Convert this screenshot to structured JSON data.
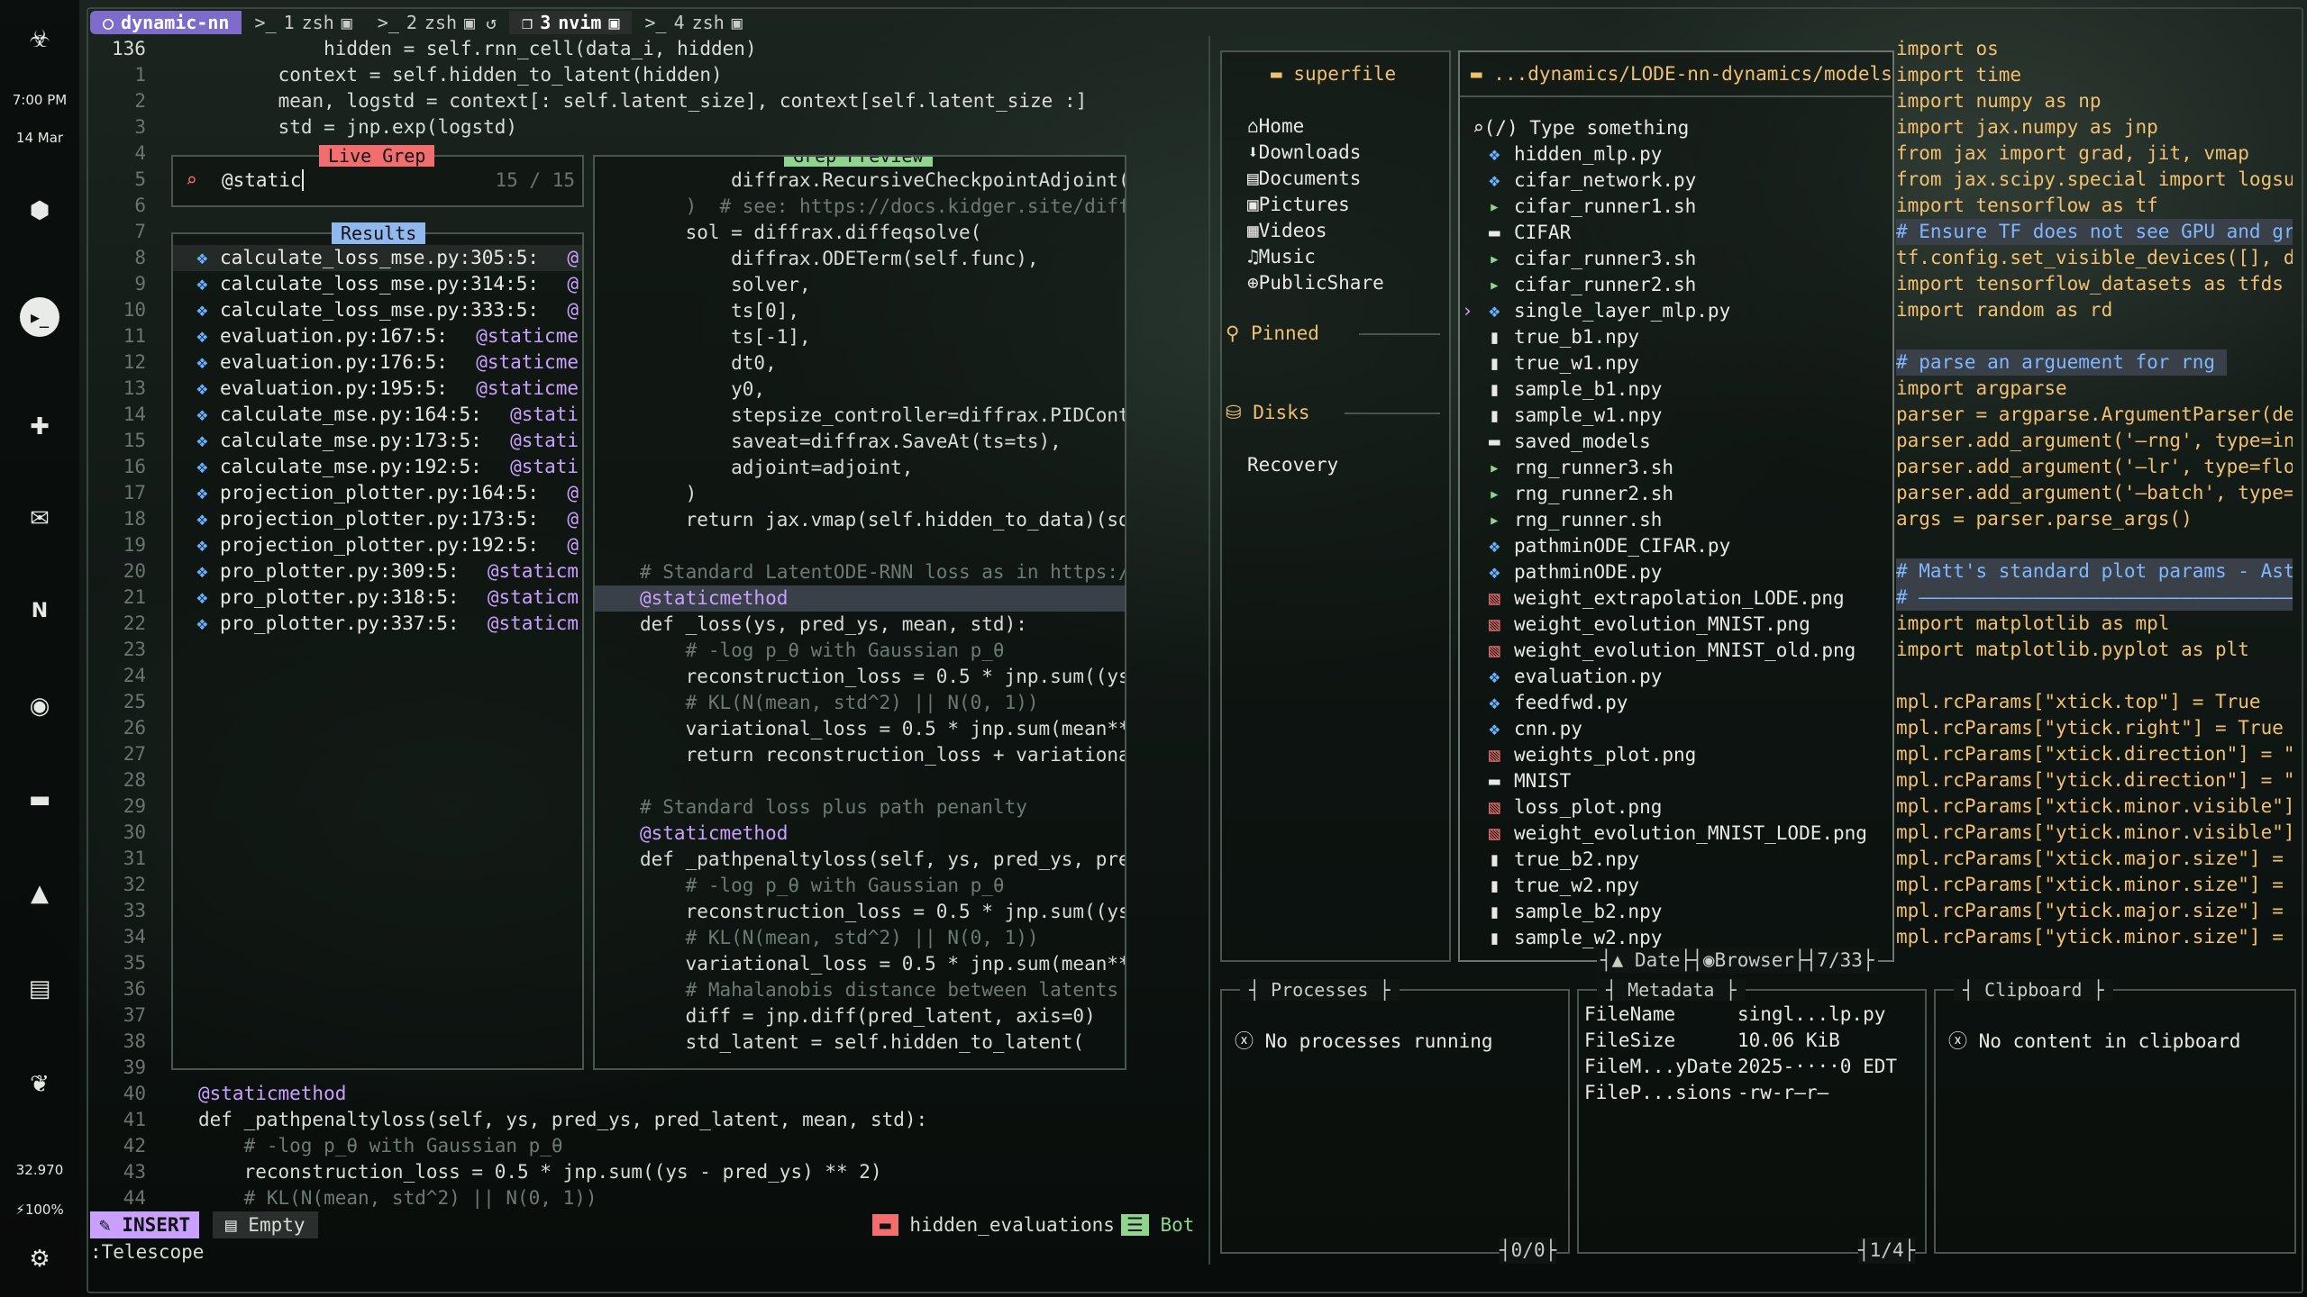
{
  "sidebar": {
    "clock_time": "7:00 PM",
    "clock_date": "14 Mar",
    "temperature": "32.970",
    "battery": "100%",
    "icons": [
      "biohazard-icon",
      "cube-icon",
      "terminal-icon",
      "slack-icon",
      "mail-icon",
      "notion-icon",
      "spotify-icon",
      "folder-icon",
      "graduation-icon",
      "notes-icon",
      "leaf-icon",
      "gear-icon"
    ]
  },
  "tabs": [
    {
      "label": "dynamic-nn",
      "num": ""
    },
    {
      "label": "zsh",
      "num": "1"
    },
    {
      "label": "zsh",
      "num": "2"
    },
    {
      "label": "nvim",
      "num": "3"
    },
    {
      "label": "zsh",
      "num": "4"
    }
  ],
  "editor": {
    "top_line_num": "136",
    "top_line": "        hidden = self.rnn_cell(data_i, hidden)",
    "lines_before": [
      {
        "n": "1",
        "t": "    context = self.hidden_to_latent(hidden)"
      },
      {
        "n": "2",
        "t": "    mean, logstd = context[: self.latent_size], context[self.latent_size :]"
      },
      {
        "n": "3",
        "t": "    std = jnp.exp(logstd)"
      }
    ],
    "gutter": [
      "4",
      "5",
      "6",
      "7",
      "8",
      "9",
      "10",
      "11",
      "12",
      "13",
      "14",
      "15",
      "16",
      "17",
      "18",
      "19",
      "20",
      "21",
      "22",
      "23",
      "24",
      "25",
      "26",
      "27",
      "28",
      "29",
      "30",
      "31",
      "32",
      "33",
      "34",
      "35",
      "36",
      "37",
      "38",
      "39"
    ],
    "lines_after": [
      {
        "n": "40",
        "t": "@staticmethod",
        "cls": "dec"
      },
      {
        "n": "41",
        "t": "def _pathpenaltyloss(self, ys, pred_ys, pred_latent, mean, std):",
        "cls": ""
      },
      {
        "n": "42",
        "t": "    # -log p_θ with Gaussian p_θ",
        "cls": "cm"
      },
      {
        "n": "43",
        "t": "    reconstruction_loss = 0.5 * jnp.sum((ys - pred_ys) ** 2)",
        "cls": ""
      },
      {
        "n": "44",
        "t": "    # KL(N(mean, std^2) || N(0, 1))",
        "cls": "cm"
      }
    ]
  },
  "telescope": {
    "live_grep_title": "Live Grep",
    "query": "@static",
    "count": "15 / 15",
    "results_title": "Results",
    "results": [
      {
        "file": "calculate_loss_mse.py:305:5:",
        "match": "@"
      },
      {
        "file": "calculate_loss_mse.py:314:5:",
        "match": "@"
      },
      {
        "file": "calculate_loss_mse.py:333:5:",
        "match": "@"
      },
      {
        "file": "evaluation.py:167:5:",
        "match": "@staticme"
      },
      {
        "file": "evaluation.py:176:5:",
        "match": "@staticme"
      },
      {
        "file": "evaluation.py:195:5:",
        "match": "@staticme"
      },
      {
        "file": "calculate_mse.py:164:5:",
        "match": "@stati"
      },
      {
        "file": "calculate_mse.py:173:5:",
        "match": "@stati"
      },
      {
        "file": "calculate_mse.py:192:5:",
        "match": "@stati"
      },
      {
        "file": "projection_plotter.py:164:5:",
        "match": "@"
      },
      {
        "file": "projection_plotter.py:173:5:",
        "match": "@"
      },
      {
        "file": "projection_plotter.py:192:5:",
        "match": "@"
      },
      {
        "file": "pro_plotter.py:309:5:",
        "match": "@staticm"
      },
      {
        "file": "pro_plotter.py:318:5:",
        "match": "@staticm"
      },
      {
        "file": "pro_plotter.py:337:5:",
        "match": "@staticm"
      }
    ],
    "preview_title": "Grep Preview",
    "preview": [
      {
        "t": "        diffrax.RecursiveCheckpointAdjoint()",
        "cls": ""
      },
      {
        "t": "    )  # see: https://docs.kidger.site/diffr",
        "cls": "cm"
      },
      {
        "t": "    sol = diffrax.diffeqsolve(",
        "cls": ""
      },
      {
        "t": "        diffrax.ODETerm(self.func),",
        "cls": ""
      },
      {
        "t": "        solver,",
        "cls": ""
      },
      {
        "t": "        ts[0],",
        "cls": ""
      },
      {
        "t": "        ts[-1],",
        "cls": ""
      },
      {
        "t": "        dt0,",
        "cls": ""
      },
      {
        "t": "        y0,",
        "cls": ""
      },
      {
        "t": "        stepsize_controller=diffrax.PIDContr",
        "cls": ""
      },
      {
        "t": "        saveat=diffrax.SaveAt(ts=ts),",
        "cls": ""
      },
      {
        "t": "        adjoint=adjoint,",
        "cls": ""
      },
      {
        "t": "    )",
        "cls": ""
      },
      {
        "t": "    return jax.vmap(self.hidden_to_data)(sol",
        "cls": ""
      },
      {
        "t": "",
        "cls": ""
      },
      {
        "t": "# Standard LatentODE-RNN loss as in https://",
        "cls": "cm"
      },
      {
        "t": "@staticmethod",
        "cls": "dec hl"
      },
      {
        "t": "def _loss(ys, pred_ys, mean, std):",
        "cls": ""
      },
      {
        "t": "    # -log p_θ with Gaussian p_θ",
        "cls": "cm"
      },
      {
        "t": "    reconstruction_loss = 0.5 * jnp.sum((ys",
        "cls": ""
      },
      {
        "t": "    # KL(N(mean, std^2) || N(0, 1))",
        "cls": "cm"
      },
      {
        "t": "    variational_loss = 0.5 * jnp.sum(mean**2",
        "cls": ""
      },
      {
        "t": "    return reconstruction_loss + variational",
        "cls": ""
      },
      {
        "t": "",
        "cls": ""
      },
      {
        "t": "# Standard loss plus path penanlty",
        "cls": "cm"
      },
      {
        "t": "@staticmethod",
        "cls": "dec"
      },
      {
        "t": "def _pathpenaltyloss(self, ys, pred_ys, pred",
        "cls": ""
      },
      {
        "t": "    # -log p_θ with Gaussian p_θ",
        "cls": "cm"
      },
      {
        "t": "    reconstruction_loss = 0.5 * jnp.sum((ys",
        "cls": ""
      },
      {
        "t": "    # KL(N(mean, std^2) || N(0, 1))",
        "cls": "cm"
      },
      {
        "t": "    variational_loss = 0.5 * jnp.sum(mean**2",
        "cls": ""
      },
      {
        "t": "    # Mahalanobis distance between latents \\",
        "cls": "cm"
      },
      {
        "t": "    diff = jnp.diff(pred_latent, axis=0)",
        "cls": ""
      },
      {
        "t": "    std_latent = self.hidden_to_latent(",
        "cls": ""
      }
    ]
  },
  "statusline": {
    "mode": "INSERT",
    "branch": "Empty",
    "filename": "hidden_evaluations",
    "position": "Bot",
    "cmdline": ":Telescope"
  },
  "superfile": {
    "title": "superfile",
    "places": [
      "Home",
      "Downloads",
      "Documents",
      "Pictures",
      "Videos",
      "Music",
      "PublicShare"
    ],
    "pinned_label": "Pinned",
    "disks_label": "Disks",
    "disks": [
      "Recovery"
    ],
    "path": "...dynamics/LODE-nn-dynamics/models",
    "search_placeholder": "(/) Type something",
    "files": [
      {
        "name": "hidden_mlp.py",
        "type": "py"
      },
      {
        "name": "cifar_network.py",
        "type": "py"
      },
      {
        "name": "cifar_runner1.sh",
        "type": "sh"
      },
      {
        "name": "CIFAR",
        "type": "dir"
      },
      {
        "name": "cifar_runner3.sh",
        "type": "sh"
      },
      {
        "name": "cifar_runner2.sh",
        "type": "sh"
      },
      {
        "name": "single_layer_mlp.py",
        "type": "py"
      },
      {
        "name": "true_b1.npy",
        "type": "file"
      },
      {
        "name": "true_w1.npy",
        "type": "file"
      },
      {
        "name": "sample_b1.npy",
        "type": "file"
      },
      {
        "name": "sample_w1.npy",
        "type": "file"
      },
      {
        "name": "saved_models",
        "type": "dir"
      },
      {
        "name": "rng_runner3.sh",
        "type": "sh"
      },
      {
        "name": "rng_runner2.sh",
        "type": "sh"
      },
      {
        "name": "rng_runner.sh",
        "type": "sh"
      },
      {
        "name": "pathminODE_CIFAR.py",
        "type": "py"
      },
      {
        "name": "pathminODE.py",
        "type": "py"
      },
      {
        "name": "weight_extrapolation_LODE.png",
        "type": "img"
      },
      {
        "name": "weight_evolution_MNIST.png",
        "type": "img"
      },
      {
        "name": "weight_evolution_MNIST_old.png",
        "type": "img"
      },
      {
        "name": "evaluation.py",
        "type": "py"
      },
      {
        "name": "feedfwd.py",
        "type": "py"
      },
      {
        "name": "cnn.py",
        "type": "py"
      },
      {
        "name": "weights_plot.png",
        "type": "img"
      },
      {
        "name": "MNIST",
        "type": "dir"
      },
      {
        "name": "loss_plot.png",
        "type": "img"
      },
      {
        "name": "weight_evolution_MNIST_LODE.png",
        "type": "img"
      },
      {
        "name": "true_b2.npy",
        "type": "file"
      },
      {
        "name": "true_w2.npy",
        "type": "file"
      },
      {
        "name": "sample_b2.npy",
        "type": "file"
      },
      {
        "name": "sample_w2.npy",
        "type": "file"
      }
    ],
    "sort_label": "Date",
    "mode_label": "Browser",
    "file_count": "7/33",
    "processes_title": "Processes",
    "processes_empty": "No processes running",
    "processes_count": "0/0",
    "metadata_title": "Metadata",
    "metadata": [
      {
        "k": "FileName",
        "v": "singl...lp.py"
      },
      {
        "k": "FileSize",
        "v": "10.06 KiB"
      },
      {
        "k": "FileM...yDate",
        "v": "2025-····0 EDT"
      },
      {
        "k": "FileP...sions",
        "v": "-rw-r—r—"
      }
    ],
    "metadata_count": "1/4",
    "clipboard_title": "Clipboard",
    "clipboard_empty": "No content in clipboard"
  },
  "preview_pane": [
    {
      "t": "import os",
      "cls": ""
    },
    {
      "t": "import time",
      "cls": ""
    },
    {
      "t": "import numpy as np",
      "cls": ""
    },
    {
      "t": "import jax.numpy as jnp",
      "cls": ""
    },
    {
      "t": "from jax import grad, jit, vmap",
      "cls": ""
    },
    {
      "t": "from jax.scipy.special import logsum",
      "cls": ""
    },
    {
      "t": "import tensorflow as tf",
      "cls": ""
    },
    {
      "t": "# Ensure TF does not see GPU and gra",
      "cls": "hlc"
    },
    {
      "t": "tf.config.set_visible_devices([], de",
      "cls": ""
    },
    {
      "t": "import tensorflow_datasets as tfds",
      "cls": ""
    },
    {
      "t": "import random as rd",
      "cls": ""
    },
    {
      "t": "",
      "cls": ""
    },
    {
      "t": "# parse an arguement for rng ",
      "cls": "hlc"
    },
    {
      "t": "import argparse",
      "cls": ""
    },
    {
      "t": "parser = argparse.ArgumentParser(des",
      "cls": ""
    },
    {
      "t": "parser.add_argument('—rng', type=in",
      "cls": ""
    },
    {
      "t": "parser.add_argument('—lr', type=flo",
      "cls": ""
    },
    {
      "t": "parser.add_argument('—batch', type=",
      "cls": ""
    },
    {
      "t": "args = parser.parse_args()",
      "cls": ""
    },
    {
      "t": "",
      "cls": ""
    },
    {
      "t": "# Matt's standard plot params - Astr",
      "cls": "hlc"
    },
    {
      "t": "# ———————————————————————————————————",
      "cls": "hlc"
    },
    {
      "t": "import matplotlib as mpl",
      "cls": ""
    },
    {
      "t": "import matplotlib.pyplot as plt",
      "cls": ""
    },
    {
      "t": "",
      "cls": ""
    },
    {
      "t": "mpl.rcParams[\"xtick.top\"] = True",
      "cls": ""
    },
    {
      "t": "mpl.rcParams[\"ytick.right\"] = True",
      "cls": ""
    },
    {
      "t": "mpl.rcParams[\"xtick.direction\"] = \"i",
      "cls": ""
    },
    {
      "t": "mpl.rcParams[\"ytick.direction\"] = \"i",
      "cls": ""
    },
    {
      "t": "mpl.rcParams[\"xtick.minor.visible\"]",
      "cls": ""
    },
    {
      "t": "mpl.rcParams[\"ytick.minor.visible\"]",
      "cls": ""
    },
    {
      "t": "mpl.rcParams[\"xtick.major.size\"] = 7",
      "cls": ""
    },
    {
      "t": "mpl.rcParams[\"xtick.minor.size\"] = 4",
      "cls": ""
    },
    {
      "t": "mpl.rcParams[\"ytick.major.size\"] = 7",
      "cls": ""
    },
    {
      "t": "mpl.rcParams[\"ytick.minor.size\"] = 4",
      "cls": ""
    }
  ]
}
